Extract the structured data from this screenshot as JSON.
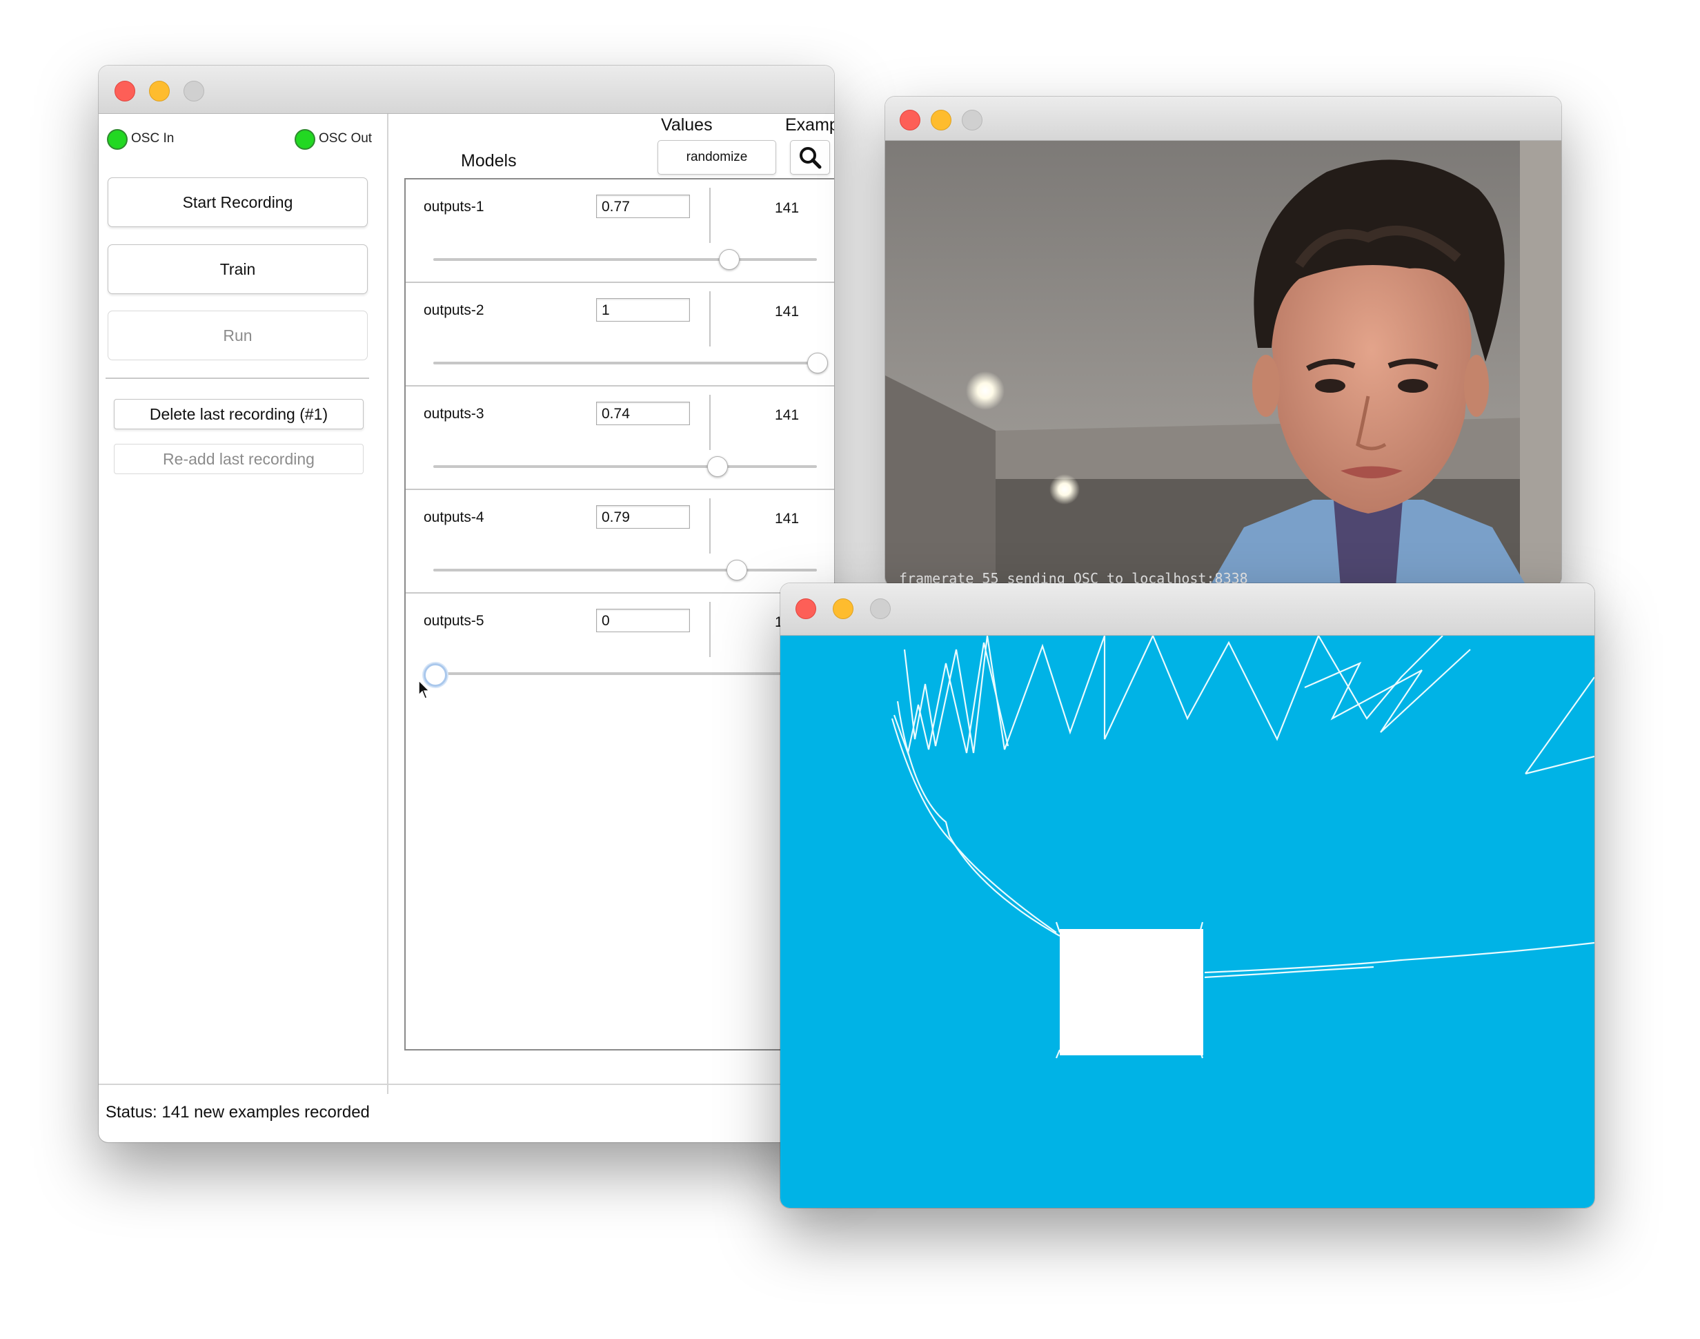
{
  "wekinator": {
    "osc_in_label": "OSC In",
    "osc_out_label": "OSC Out",
    "buttons": {
      "start_recording": "Start Recording",
      "train": "Train",
      "run": "Run",
      "delete_last": "Delete last recording (#1)",
      "readd_last": "Re-add last recording"
    },
    "headers": {
      "models": "Models",
      "values": "Values",
      "examples": "Examp",
      "randomize": "randomize"
    },
    "outputs": [
      {
        "name": "outputs-1",
        "value": "0.77",
        "count": "141",
        "slider_fraction": 0.77
      },
      {
        "name": "outputs-2",
        "value": "1",
        "count": "141",
        "slider_fraction": 1.0
      },
      {
        "name": "outputs-3",
        "value": "0.74",
        "count": "141",
        "slider_fraction": 0.74
      },
      {
        "name": "outputs-4",
        "value": "0.79",
        "count": "141",
        "slider_fraction": 0.79
      },
      {
        "name": "outputs-5",
        "value": "0",
        "count": "1",
        "slider_fraction": 0.0
      }
    ],
    "status": "Status:  141 new examples recorded",
    "led_color": "#22d822"
  },
  "camera": {
    "overlay_text": "framerate 55 sending OSC to localhost:8338"
  },
  "canvas": {
    "background": "#00b3e6"
  }
}
